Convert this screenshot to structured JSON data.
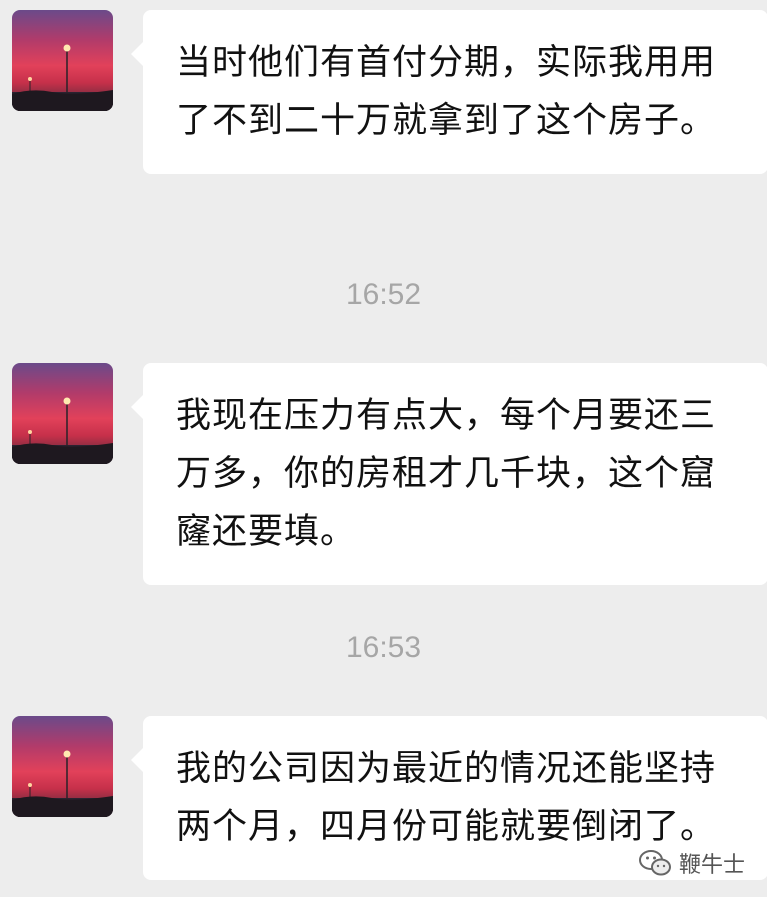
{
  "messages": [
    {
      "text": "当时他们有首付分期，实际我用用了不到二十万就拿到了这个房子。"
    },
    {
      "text": "我现在压力有点大，每个月要还三万多，你的房租才几千块，这个窟窿还要填。"
    },
    {
      "text": "我的公司因为最近的情况还能坚持两个月，四月份可能就要倒闭了。"
    }
  ],
  "timestamps": [
    "16:52",
    "16:53"
  ],
  "watermark": {
    "label": "鞭牛士",
    "icon": "wechat-icon"
  },
  "colors": {
    "background": "#ededed",
    "bubble": "#ffffff",
    "timestamp": "#a6a6a6",
    "text": "#111111"
  }
}
